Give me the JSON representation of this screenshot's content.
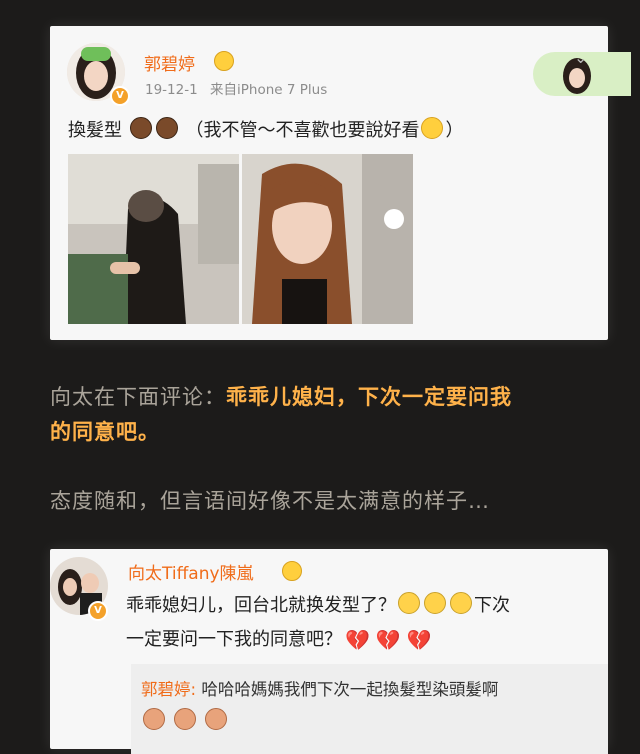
{
  "post": {
    "username": "郭碧婷",
    "date": "19-12-1",
    "source": "来自iPhone 7 Plus",
    "text_before": "換髮型",
    "text_after": "（我不管～不喜歡也要說好看",
    "text_close": "）",
    "emojis": [
      "boy-face-icon",
      "boy-face-icon",
      "yummy-face-icon"
    ]
  },
  "narration": {
    "line1_prefix": "向太在下面评论：",
    "line1_highlight": "乖乖儿媳妇，下次一定要问我",
    "line2_highlight": "的同意吧。",
    "line3": "态度随和，但言语间好像不是太满意的样子…"
  },
  "comment": {
    "username": "向太Tiffany陳嵐",
    "line1": "乖乖媳妇儿，回台北就换发型了？",
    "line1_tail": "下次",
    "line2": "一定要问一下我的同意吧？",
    "reply_user": "郭碧婷:",
    "reply_text": "哈哈哈媽媽我們下次一起換髮型染頭髮啊"
  },
  "colors": {
    "username": "#f06c1a",
    "highlight": "#ffb24a",
    "narration": "#aaa49a",
    "background": "#1c1b1a"
  }
}
